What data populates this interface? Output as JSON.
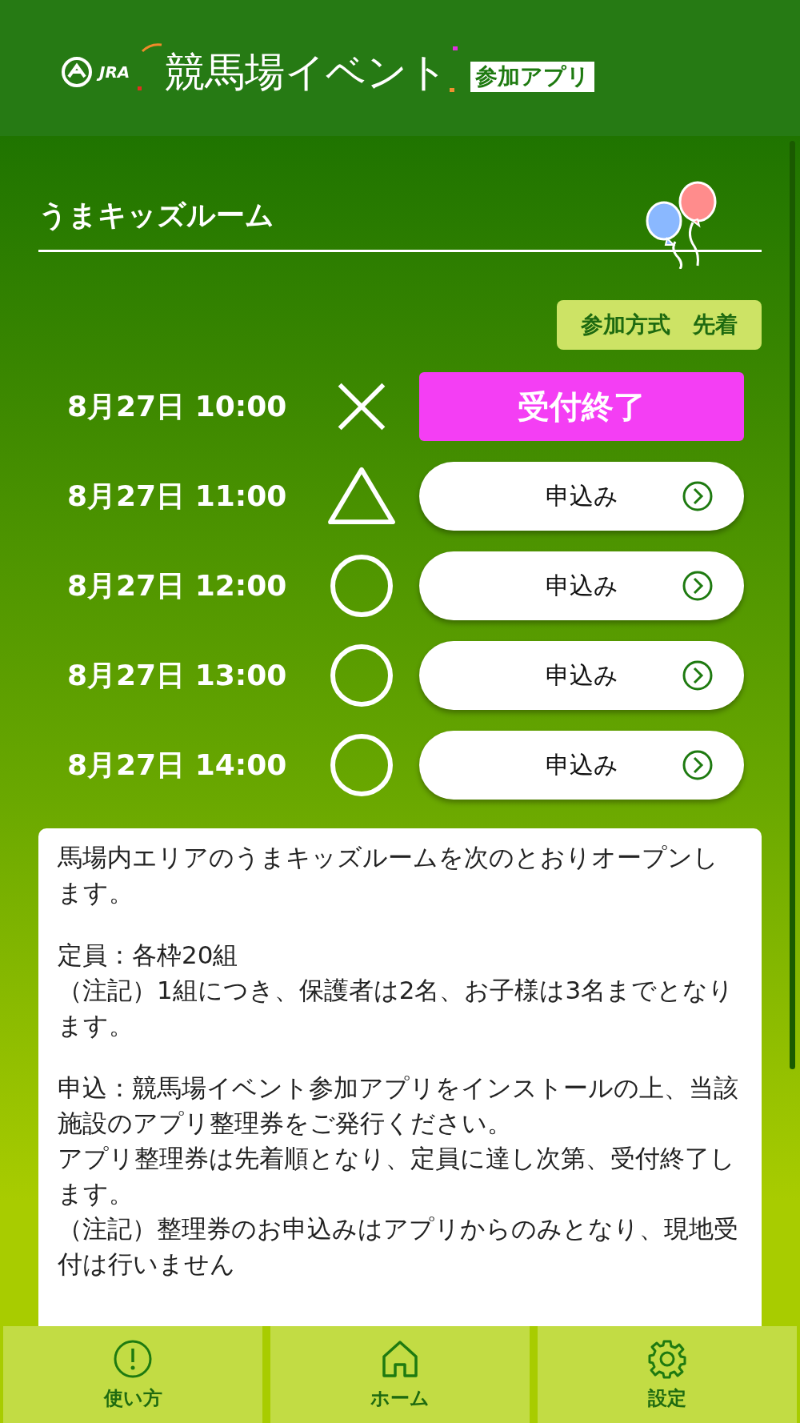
{
  "header": {
    "org": "JRA",
    "title": "競馬場イベント",
    "badge": "参加アプリ"
  },
  "event": {
    "title": "うまキッズルーム",
    "method": "参加方式　先着"
  },
  "slots": [
    {
      "time": "8月27日 10:00",
      "kind": "closed",
      "button": "受付終了"
    },
    {
      "time": "8月27日 11:00",
      "kind": "few",
      "button": "申込み"
    },
    {
      "time": "8月27日 12:00",
      "kind": "open",
      "button": "申込み"
    },
    {
      "time": "8月27日 13:00",
      "kind": "open",
      "button": "申込み"
    },
    {
      "time": "8月27日 14:00",
      "kind": "open",
      "button": "申込み"
    }
  ],
  "description": [
    [
      "馬場内エリアのうまキッズルームを次のとおりオープンします。"
    ],
    [
      "定員：各枠20組",
      "（注記）1組につき、保護者は2名、お子様は3名までとなります。"
    ],
    [
      "申込：競馬場イベント参加アプリをインストールの上、当該施設のアプリ整理券をご発行ください。",
      "アプリ整理券は先着順となり、定員に達し次第、受付終了します。",
      "（注記）整理券のお申込みはアプリからのみとなり、現地受付は行いません"
    ]
  ],
  "nav": [
    {
      "kind": "help",
      "label": "使い方"
    },
    {
      "kind": "home",
      "label": "ホーム"
    },
    {
      "kind": "settings",
      "label": "設定"
    }
  ]
}
